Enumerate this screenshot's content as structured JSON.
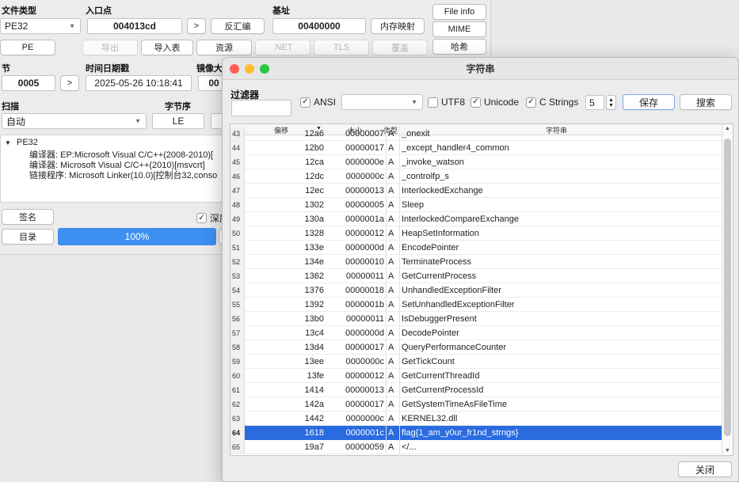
{
  "main": {
    "file_type_label": "文件类型",
    "file_type_value": "PE32",
    "entry_label": "入口点",
    "entry_value": "004013cd",
    "entry_go": ">",
    "disasm_btn": "反汇编",
    "base_label": "基址",
    "base_value": "00400000",
    "memmap_btn": "内存映射",
    "fileinfo_btn": "File info",
    "mime_btn": "MIME",
    "pe_btn": "PE",
    "export_btn": "导出",
    "import_btn": "导入表",
    "resource_btn": "资源",
    "net_btn": ".NET",
    "tls_btn": "TLS",
    "overlay_btn": "覆盖",
    "hash_btn": "哈希",
    "sections_label": "节",
    "sections_value": "0005",
    "sections_go": ">",
    "timestamp_label": "时间日期戳",
    "timestamp_value": "2025-05-26 10:18:41",
    "image_size_label": "镜像大",
    "image_size_value": "00",
    "scan_label": "扫描",
    "scan_value": "自动",
    "endian_label": "字节序",
    "endian_value": "LE",
    "tree_root": "PE32",
    "tree_lines": [
      "编译器: EP:Microsoft Visual C/C++(2008-2010)[",
      "编译器: Microsoft Visual C/C++(2010)[msvcrt]",
      "链接程序: Microsoft Linker(10.0)[控制台32,conso"
    ],
    "sign_btn": "签名",
    "deep_scan_label": "深度",
    "dir_btn": "目录",
    "progress_text": "100%",
    "progress_value": 1.0
  },
  "strings": {
    "title": "字符串",
    "filter_label": "过滤器",
    "filter_value": "",
    "ansi_label": "ANSI",
    "ansi_checked": true,
    "encoding_value": "",
    "utf8_label": "UTF8",
    "utf8_checked": false,
    "unicode_label": "Unicode",
    "unicode_checked": true,
    "cstrings_label": "C Strings",
    "cstrings_checked": true,
    "min_length": "5",
    "save_btn": "保存",
    "search_btn": "搜索",
    "close_btn": "关闭",
    "columns": {
      "offset": "偏移",
      "size": "大小",
      "type": "类型",
      "string": "字符串"
    },
    "partial_row": {
      "index": "43",
      "offset": "12a6",
      "size": "00000007",
      "type": "A",
      "string": "_onexit"
    },
    "rows": [
      {
        "index": "44",
        "offset": "12b0",
        "size": "00000017",
        "type": "A",
        "string": "_except_handler4_common"
      },
      {
        "index": "45",
        "offset": "12ca",
        "size": "0000000e",
        "type": "A",
        "string": "_invoke_watson"
      },
      {
        "index": "46",
        "offset": "12dc",
        "size": "0000000c",
        "type": "A",
        "string": "_controlfp_s"
      },
      {
        "index": "47",
        "offset": "12ec",
        "size": "00000013",
        "type": "A",
        "string": "InterlockedExchange"
      },
      {
        "index": "48",
        "offset": "1302",
        "size": "00000005",
        "type": "A",
        "string": "Sleep"
      },
      {
        "index": "49",
        "offset": "130a",
        "size": "0000001a",
        "type": "A",
        "string": "InterlockedCompareExchange"
      },
      {
        "index": "50",
        "offset": "1328",
        "size": "00000012",
        "type": "A",
        "string": "HeapSetInformation"
      },
      {
        "index": "51",
        "offset": "133e",
        "size": "0000000d",
        "type": "A",
        "string": "EncodePointer"
      },
      {
        "index": "52",
        "offset": "134e",
        "size": "00000010",
        "type": "A",
        "string": "TerminateProcess"
      },
      {
        "index": "53",
        "offset": "1362",
        "size": "00000011",
        "type": "A",
        "string": "GetCurrentProcess"
      },
      {
        "index": "54",
        "offset": "1376",
        "size": "00000018",
        "type": "A",
        "string": "UnhandledExceptionFilter"
      },
      {
        "index": "55",
        "offset": "1392",
        "size": "0000001b",
        "type": "A",
        "string": "SetUnhandledExceptionFilter"
      },
      {
        "index": "56",
        "offset": "13b0",
        "size": "00000011",
        "type": "A",
        "string": "IsDebuggerPresent"
      },
      {
        "index": "57",
        "offset": "13c4",
        "size": "0000000d",
        "type": "A",
        "string": "DecodePointer"
      },
      {
        "index": "58",
        "offset": "13d4",
        "size": "00000017",
        "type": "A",
        "string": "QueryPerformanceCounter"
      },
      {
        "index": "59",
        "offset": "13ee",
        "size": "0000000c",
        "type": "A",
        "string": "GetTickCount"
      },
      {
        "index": "60",
        "offset": "13fe",
        "size": "00000012",
        "type": "A",
        "string": "GetCurrentThreadId"
      },
      {
        "index": "61",
        "offset": "1414",
        "size": "00000013",
        "type": "A",
        "string": "GetCurrentProcessId"
      },
      {
        "index": "62",
        "offset": "142a",
        "size": "00000017",
        "type": "A",
        "string": "GetSystemTimeAsFileTime"
      },
      {
        "index": "63",
        "offset": "1442",
        "size": "0000000c",
        "type": "A",
        "string": "KERNEL32.dll"
      },
      {
        "index": "64",
        "offset": "1618",
        "size": "0000001c",
        "type": "A",
        "string": "flag{1_am_y0ur_fr1nd_strngs}",
        "selected": true
      },
      {
        "index": "65",
        "offset": "19a7",
        "size": "00000059",
        "type": "A",
        "string": "</..."
      }
    ]
  },
  "colors": {
    "accent": "#3d8ff0",
    "selection": "#2a6be0",
    "traffic_red": "#ff5f57",
    "traffic_yellow": "#febc2e",
    "traffic_green": "#28c840"
  }
}
